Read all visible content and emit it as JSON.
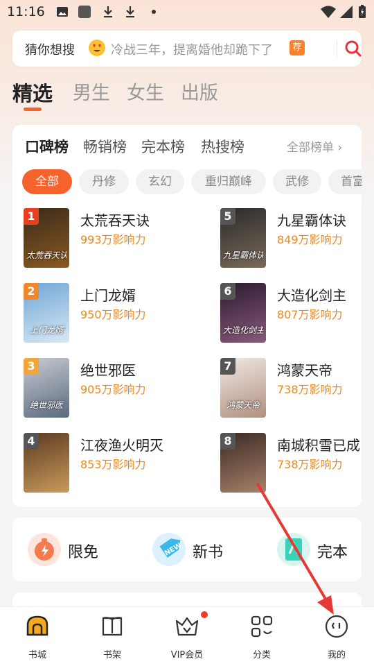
{
  "status_bar": {
    "time": "11:16"
  },
  "search": {
    "placeholder_prefix": "猜你想搜",
    "query": "冷战三年，提离婚他却跪下了",
    "tag": "荐"
  },
  "top_tabs": [
    "精选",
    "男生",
    "女生",
    "出版"
  ],
  "rank_tabs": [
    "口碑榜",
    "畅销榜",
    "完本榜",
    "热搜榜"
  ],
  "rank_all": "全部榜单 ›",
  "chips": [
    "全部",
    "丹修",
    "玄幻",
    "重归巅峰",
    "武修",
    "首富"
  ],
  "books": [
    {
      "rank": "1",
      "title": "太荒吞天诀",
      "meta": "993万影响力",
      "cover_text": "太荒吞天诀",
      "badge_color": "#e8401e",
      "cover_colors": [
        "#3a2a1a",
        "#8a5a20"
      ]
    },
    {
      "rank": "2",
      "title": "上门龙婿",
      "meta": "950万影响力",
      "cover_text": "上门龙婿",
      "badge_color": "#f0872b",
      "cover_colors": [
        "#6fa6d6",
        "#d8e8f4"
      ]
    },
    {
      "rank": "3",
      "title": "绝世邪医",
      "meta": "905万影响力",
      "cover_text": "绝世邪医",
      "badge_color": "#f3a53a",
      "cover_colors": [
        "#c9cbd0",
        "#5a6a80"
      ]
    },
    {
      "rank": "4",
      "title": "江夜渔火明灭",
      "meta": "853万影响力",
      "cover_text": "",
      "badge_color": "#555555",
      "cover_colors": [
        "#5a3a22",
        "#c99a5a"
      ]
    },
    {
      "rank": "5",
      "title": "九星霸体诀",
      "meta": "849万影响力",
      "cover_text": "九星霸体诀",
      "badge_color": "#555555",
      "cover_colors": [
        "#2a2a2a",
        "#7a6a5a"
      ]
    },
    {
      "rank": "6",
      "title": "大造化剑主",
      "meta": "807万影响力",
      "cover_text": "大造化剑主",
      "badge_color": "#555555",
      "cover_colors": [
        "#2a1a2e",
        "#8a5a7a"
      ]
    },
    {
      "rank": "7",
      "title": "鸿蒙天帝",
      "meta": "738万影响力",
      "cover_text": "鸿蒙天帝",
      "badge_color": "#555555",
      "cover_colors": [
        "#f0e8e4",
        "#b09080"
      ]
    },
    {
      "rank": "8",
      "title": "南城积雪已成",
      "meta": "738万影响力",
      "cover_text": "",
      "badge_color": "#555555",
      "cover_colors": [
        "#3a2a24",
        "#a8806a"
      ]
    }
  ],
  "shortcuts": [
    {
      "label": "限免",
      "icon": "stopwatch-icon",
      "color": "#f57a4e"
    },
    {
      "label": "新书",
      "icon": "new-tag-icon",
      "color": "#3bb8e8"
    },
    {
      "label": "完本",
      "icon": "book-complete-icon",
      "color": "#38d3b8"
    }
  ],
  "bottom_nav": [
    {
      "label": "书城",
      "icon": "bookstore-icon"
    },
    {
      "label": "书架",
      "icon": "bookshelf-icon"
    },
    {
      "label": "VIP会员",
      "icon": "vip-crown-icon"
    },
    {
      "label": "分类",
      "icon": "category-icon"
    },
    {
      "label": "我的",
      "icon": "profile-icon"
    }
  ],
  "colors": {
    "accent": "#f6622b",
    "influence_text": "#e48a24",
    "annotation_arrow": "#e53935"
  }
}
